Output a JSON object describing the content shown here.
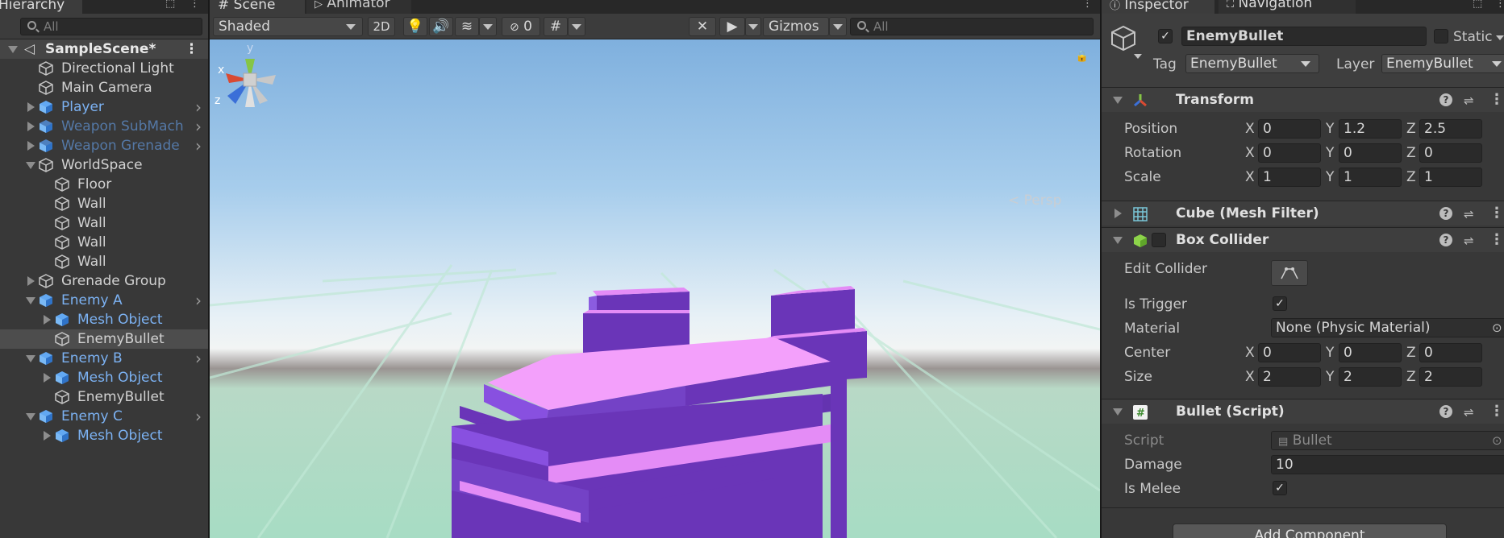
{
  "hierarchy": {
    "tab_label": "Hierarchy",
    "search_placeholder": "All",
    "scene_name": "SampleScene*",
    "items": [
      {
        "label": "Directional Light",
        "indent": 1,
        "fold": "none",
        "style": "normal"
      },
      {
        "label": "Main Camera",
        "indent": 1,
        "fold": "none",
        "style": "normal"
      },
      {
        "label": "Player",
        "indent": 1,
        "fold": "closed",
        "style": "prefab"
      },
      {
        "label": "Weapon SubMach",
        "indent": 1,
        "fold": "closed",
        "style": "prefab-dim"
      },
      {
        "label": "Weapon Grenade",
        "indent": 1,
        "fold": "closed",
        "style": "prefab-dim"
      },
      {
        "label": "WorldSpace",
        "indent": 1,
        "fold": "open",
        "style": "normal"
      },
      {
        "label": "Floor",
        "indent": 2,
        "fold": "none",
        "style": "normal"
      },
      {
        "label": "Wall",
        "indent": 2,
        "fold": "none",
        "style": "normal"
      },
      {
        "label": "Wall",
        "indent": 2,
        "fold": "none",
        "style": "normal"
      },
      {
        "label": "Wall",
        "indent": 2,
        "fold": "none",
        "style": "normal"
      },
      {
        "label": "Wall",
        "indent": 2,
        "fold": "none",
        "style": "normal"
      },
      {
        "label": "Grenade Group",
        "indent": 1,
        "fold": "closed",
        "style": "normal"
      },
      {
        "label": "Enemy A",
        "indent": 1,
        "fold": "open",
        "style": "prefab"
      },
      {
        "label": "Mesh Object",
        "indent": 2,
        "fold": "closed",
        "style": "prefab"
      },
      {
        "label": "EnemyBullet",
        "indent": 2,
        "fold": "none",
        "style": "normal",
        "selected": true
      },
      {
        "label": "Enemy B",
        "indent": 1,
        "fold": "open",
        "style": "prefab"
      },
      {
        "label": "Mesh Object",
        "indent": 2,
        "fold": "closed",
        "style": "prefab"
      },
      {
        "label": "EnemyBullet",
        "indent": 2,
        "fold": "none",
        "style": "normal"
      },
      {
        "label": "Enemy C",
        "indent": 1,
        "fold": "open",
        "style": "prefab"
      },
      {
        "label": "Mesh Object",
        "indent": 2,
        "fold": "closed",
        "style": "prefab"
      }
    ]
  },
  "scene": {
    "tab_scene": "# Scene",
    "tab_animator": "Animator",
    "shading_mode": "Shaded",
    "mode_2d": "2D",
    "hidden_count": "0",
    "gizmos_label": "Gizmos",
    "search_placeholder": "All",
    "persp_label": "< Persp",
    "gizmo_axes": {
      "y": "y",
      "x": "x",
      "z": "z"
    }
  },
  "inspector": {
    "tab_inspector": "Inspector",
    "tab_navigation": "Navigation",
    "object_name": "EnemyBullet",
    "static_label": "Static",
    "tag_label": "Tag",
    "tag_value": "EnemyBullet",
    "layer_label": "Layer",
    "layer_value": "EnemyBullet",
    "transform": {
      "title": "Transform",
      "position_label": "Position",
      "position": {
        "x": "0",
        "y": "1.2",
        "z": "2.5"
      },
      "rotation_label": "Rotation",
      "rotation": {
        "x": "0",
        "y": "0",
        "z": "0"
      },
      "scale_label": "Scale",
      "scale": {
        "x": "1",
        "y": "1",
        "z": "1"
      }
    },
    "mesh_filter": {
      "title": "Cube (Mesh Filter)"
    },
    "box_collider": {
      "title": "Box Collider",
      "edit_collider_label": "Edit Collider",
      "is_trigger_label": "Is Trigger",
      "material_label": "Material",
      "material_value": "None (Physic Material)",
      "center_label": "Center",
      "center": {
        "x": "0",
        "y": "0",
        "z": "0"
      },
      "size_label": "Size",
      "size": {
        "x": "2",
        "y": "2",
        "z": "2"
      }
    },
    "bullet_script": {
      "title": "Bullet (Script)",
      "script_label": "Script",
      "script_value": "Bullet",
      "damage_label": "Damage",
      "damage_value": "10",
      "is_melee_label": "Is Melee"
    },
    "axis_x": "X",
    "axis_y": "Y",
    "axis_z": "Z",
    "add_component": "Add Component"
  }
}
